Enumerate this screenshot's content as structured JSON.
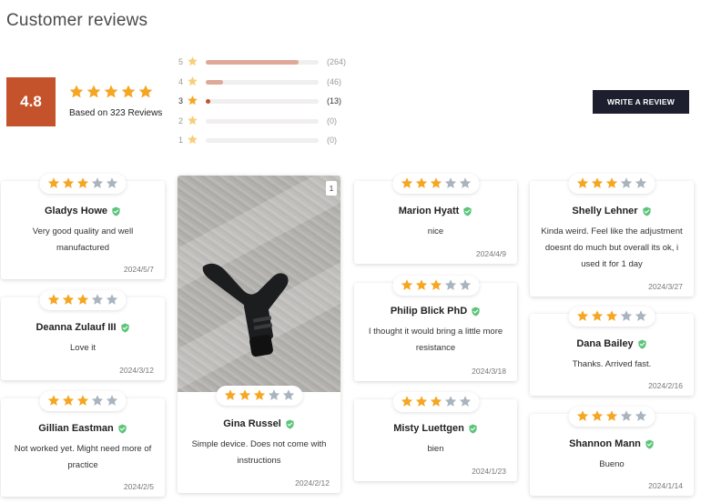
{
  "page": {
    "title": "Customer reviews"
  },
  "summary": {
    "score": "4.8",
    "stars": 5,
    "based_on": "Based on 323 Reviews",
    "distribution": [
      {
        "star": "5",
        "count": "(264)",
        "fraction": 0.82,
        "color": "#dfa898",
        "active": false
      },
      {
        "star": "4",
        "count": "(46)",
        "fraction": 0.15,
        "color": "#dfa898",
        "active": false
      },
      {
        "star": "3",
        "count": "(13)",
        "fraction": 0.04,
        "color": "#c4532b",
        "active": true
      },
      {
        "star": "2",
        "count": "(0)",
        "fraction": 0,
        "color": "#dfa898",
        "active": false
      },
      {
        "star": "1",
        "count": "(0)",
        "fraction": 0,
        "color": "#dfa898",
        "active": false
      }
    ]
  },
  "actions": {
    "write_review": "WRITE A REVIEW"
  },
  "colors": {
    "star_filled": "#f5a623",
    "star_empty": "#a9b4bf",
    "verified": "#5cc57a",
    "accent": "#c4532b"
  },
  "reviews": {
    "gladys": {
      "name": "Gladys Howe",
      "rating": 3,
      "body": "Very good quality and well manufactured",
      "date": "2024/5/7"
    },
    "deanna": {
      "name": "Deanna Zulauf III",
      "rating": 3,
      "body": "Love it",
      "date": "2024/3/12"
    },
    "gillian": {
      "name": "Gillian Eastman",
      "rating": 3,
      "body": "Not worked yet. Might need more of practice",
      "date": "2024/2/5"
    },
    "gina": {
      "name": "Gina Russel",
      "rating": 3,
      "body": "Simple device. Does not come with instructions",
      "date": "2024/2/12",
      "photo_count": "1"
    },
    "marion": {
      "name": "Marion Hyatt",
      "rating": 3,
      "body": "nice",
      "date": "2024/4/9"
    },
    "philip": {
      "name": "Philip Blick PhD",
      "rating": 3,
      "body": "I thought it would bring a little more resistance",
      "date": "2024/3/18"
    },
    "misty": {
      "name": "Misty Luettgen",
      "rating": 3,
      "body": "bien",
      "date": "2024/1/23"
    },
    "shelly": {
      "name": "Shelly Lehner",
      "rating": 3,
      "body": "Kinda weird. Feel like the adjustment doesnt do much but overall its ok, i used it for 1 day",
      "date": "2024/3/27"
    },
    "dana": {
      "name": "Dana Bailey",
      "rating": 3,
      "body": "Thanks. Arrived fast.",
      "date": "2024/2/16"
    },
    "shannon": {
      "name": "Shannon Mann",
      "rating": 3,
      "body": "Bueno",
      "date": "2024/1/14"
    }
  }
}
